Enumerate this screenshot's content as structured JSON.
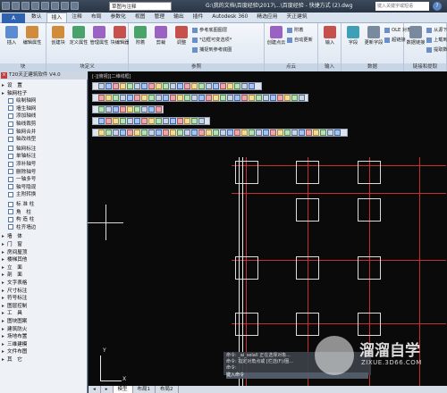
{
  "titlebar": {
    "workspace": "草图与注释",
    "title": "G:\\我的文档\\百度经验\\2017\\...\\百度经验 - 快捷方式 (2).dwg",
    "search_placeholder": "键入关键字或短语"
  },
  "ribbon_tabs": [
    "数认",
    "插入",
    "注释",
    "布局",
    "参数化",
    "视图",
    "管理",
    "输出",
    "插件",
    "Autodesk 360",
    "精选应用",
    "天正建筑"
  ],
  "ribbon_active_tab": "插入",
  "ribbon_groups": [
    {
      "label": "块",
      "buttons": [
        "插入",
        "编辑属性"
      ]
    },
    {
      "label": "块定义",
      "buttons": [
        "创建块",
        "定义属性",
        "管理属性",
        "块编辑器"
      ]
    },
    {
      "label": "参照",
      "buttons": [
        "附着",
        "剪裁",
        "调整"
      ],
      "small": [
        "参考底图图层",
        "*边框可变选项*",
        "捕捉到参考底图"
      ]
    },
    {
      "label": "点云",
      "buttons": [
        "创建点云"
      ],
      "small": [
        "附着",
        "自动更新"
      ]
    },
    {
      "label": "输入",
      "buttons": [
        "输入"
      ]
    },
    {
      "label": "数据",
      "buttons": [
        "字段",
        "更新字段"
      ],
      "small": [
        "OLE 对象",
        "超链接"
      ]
    },
    {
      "label": "链接和提取",
      "buttons": [
        "数据链接"
      ],
      "small": [
        "从源下载",
        "上载到源",
        "提取数据"
      ]
    }
  ],
  "left_panel": {
    "title": "T20天正建筑软件 V4.0",
    "items": [
      {
        "label": "设　置",
        "type": "group"
      },
      {
        "label": "轴网柱子",
        "type": "group"
      },
      {
        "label": "绘制轴网",
        "type": "sub"
      },
      {
        "label": "墙生轴网",
        "type": "sub"
      },
      {
        "label": "添加轴线",
        "type": "sub"
      },
      {
        "label": "轴线裁剪",
        "type": "sub"
      },
      {
        "label": "轴网合并",
        "type": "sub"
      },
      {
        "label": "轴改线型",
        "type": "sub"
      },
      {
        "label": "",
        "type": "sep"
      },
      {
        "label": "轴网标注",
        "type": "sub"
      },
      {
        "label": "单轴标注",
        "type": "sub"
      },
      {
        "label": "添补轴号",
        "type": "sub"
      },
      {
        "label": "删除轴号",
        "type": "sub"
      },
      {
        "label": "一轴多号",
        "type": "sub"
      },
      {
        "label": "轴号隐现",
        "type": "sub"
      },
      {
        "label": "主附转换",
        "type": "sub"
      },
      {
        "label": "",
        "type": "sep"
      },
      {
        "label": "标 准 柱",
        "type": "sub"
      },
      {
        "label": "角　柱",
        "type": "sub"
      },
      {
        "label": "构 造 柱",
        "type": "sub"
      },
      {
        "label": "柱齐墙边",
        "type": "sub"
      },
      {
        "label": "",
        "type": "sep"
      },
      {
        "label": "墙　体",
        "type": "group"
      },
      {
        "label": "门　窗",
        "type": "group"
      },
      {
        "label": "房间屋顶",
        "type": "group"
      },
      {
        "label": "楼梯其他",
        "type": "group"
      },
      {
        "label": "立　面",
        "type": "group"
      },
      {
        "label": "剖　面",
        "type": "group"
      },
      {
        "label": "文字表格",
        "type": "group"
      },
      {
        "label": "尺寸标注",
        "type": "group"
      },
      {
        "label": "符号标注",
        "type": "group"
      },
      {
        "label": "图层控制",
        "type": "group"
      },
      {
        "label": "工　具",
        "type": "group"
      },
      {
        "label": "图块图案",
        "type": "group"
      },
      {
        "label": "建筑防火",
        "type": "group"
      },
      {
        "label": "场地布置",
        "type": "group"
      },
      {
        "label": "三维建模",
        "type": "group"
      },
      {
        "label": "文件布图",
        "type": "group"
      },
      {
        "label": "其　它",
        "type": "group"
      }
    ]
  },
  "canvas": {
    "view_label": "[-][俯视][二维线框]"
  },
  "command_line": {
    "lines": [
      "命令: _ai_selall 正在选择对象...",
      "命令: 指定对角点或 [栏选(F)/圈...",
      "命令:"
    ],
    "input_prompt": "键入命令"
  },
  "ucs": {
    "x": "X",
    "y": "Y"
  },
  "model_tabs": [
    "模型",
    "布局1",
    "布局2"
  ],
  "model_tab_active": "模型",
  "watermark": {
    "brand": "溜溜自学",
    "url": "ZIXUE.3D66.COM"
  },
  "colors": {
    "axis_red": "#c83030",
    "canvas_bg": "#0a0a0a",
    "ribbon_accent": "#2f63b0"
  }
}
